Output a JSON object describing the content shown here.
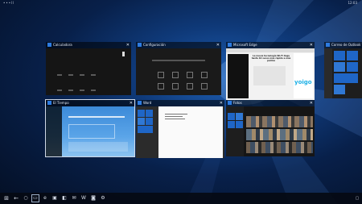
{
  "status_bar": {
    "signal": "•••ll",
    "time": "12:03"
  },
  "apps": [
    {
      "title": "Calculadora"
    },
    {
      "title": "Configuración"
    },
    {
      "title": "Microsoft Edge"
    },
    {
      "title": "Correo de Outlook"
    },
    {
      "title": "El Tiempo"
    },
    {
      "title": "Word"
    },
    {
      "title": "Fotos"
    }
  ],
  "edge_page": {
    "headline": "La nueva tecnología Wi-Fi llega hasta 10 veces más rápido a más puntos",
    "brand": "yoigo"
  },
  "colors": {
    "accent": "#1e6fd9",
    "tile_blue": "#1f66c7",
    "dark_app": "#1c1c1c"
  }
}
